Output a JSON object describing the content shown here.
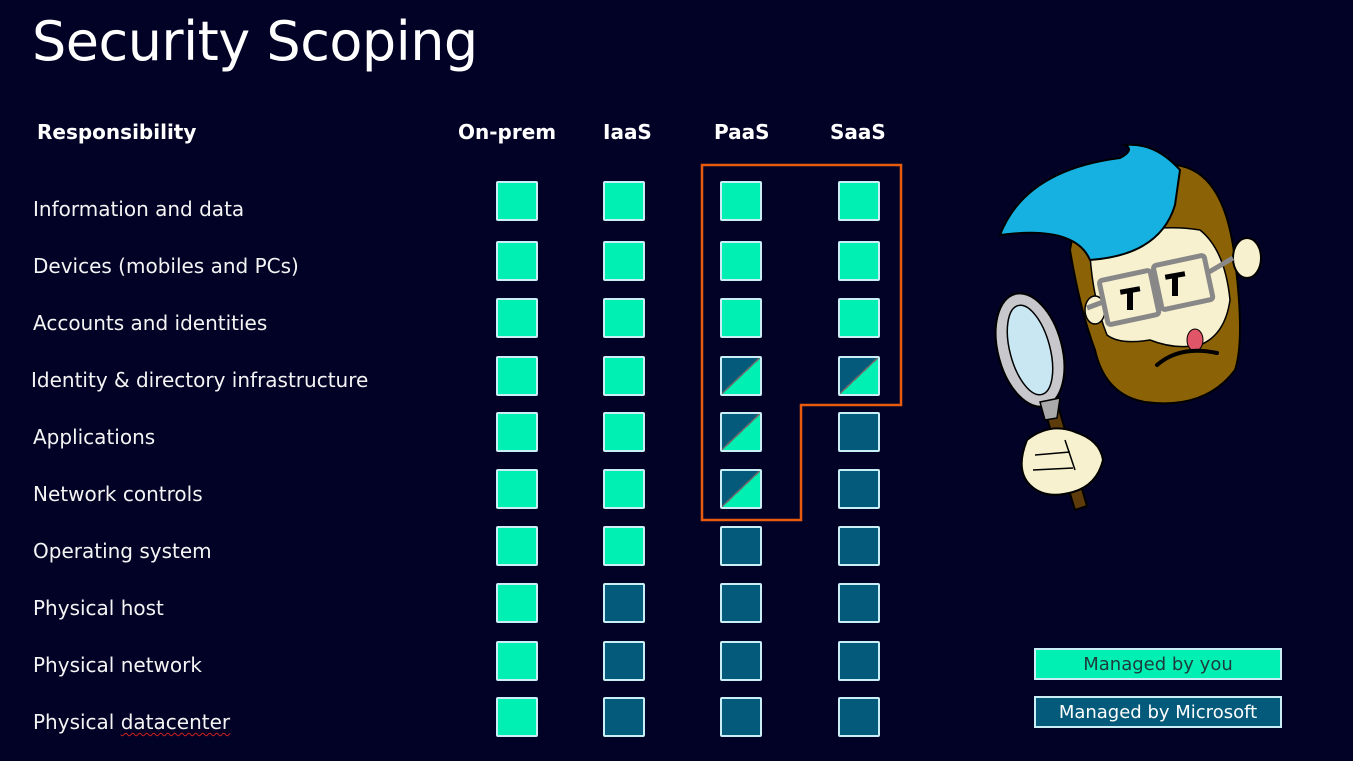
{
  "title": "Security Scoping",
  "header": {
    "responsibility": "Responsibility",
    "columns": [
      "On-prem",
      "IaaS",
      "PaaS",
      "SaaS"
    ]
  },
  "rows": [
    {
      "label": "Information and data",
      "cells": [
        "you",
        "you",
        "you",
        "you"
      ]
    },
    {
      "label": "Devices (mobiles and PCs)",
      "cells": [
        "you",
        "you",
        "you",
        "you"
      ]
    },
    {
      "label": "Accounts and identities",
      "cells": [
        "you",
        "you",
        "you",
        "you"
      ]
    },
    {
      "label": "Identity & directory infrastructure",
      "cells": [
        "you",
        "you",
        "shared",
        "shared"
      ]
    },
    {
      "label": "Applications",
      "cells": [
        "you",
        "you",
        "shared",
        "ms"
      ]
    },
    {
      "label": "Network controls",
      "cells": [
        "you",
        "you",
        "shared",
        "ms"
      ]
    },
    {
      "label": "Operating system",
      "cells": [
        "you",
        "you",
        "ms",
        "ms"
      ]
    },
    {
      "label": "Physical host",
      "cells": [
        "you",
        "ms",
        "ms",
        "ms"
      ]
    },
    {
      "label": "Physical network",
      "cells": [
        "you",
        "ms",
        "ms",
        "ms"
      ]
    },
    {
      "label": "Physical datacenter",
      "cells": [
        "you",
        "ms",
        "ms",
        "ms"
      ]
    }
  ],
  "legend": {
    "you": "Managed by you",
    "ms": "Managed by Microsoft"
  },
  "colors": {
    "background": "#020226",
    "managed_by_you": "#00efb3",
    "managed_by_microsoft": "#045a7a",
    "scope_outline": "#e85a0c",
    "cell_border": "#c9eef5"
  },
  "mascot": {
    "icon": "detective-with-magnifying-glass-icon"
  }
}
